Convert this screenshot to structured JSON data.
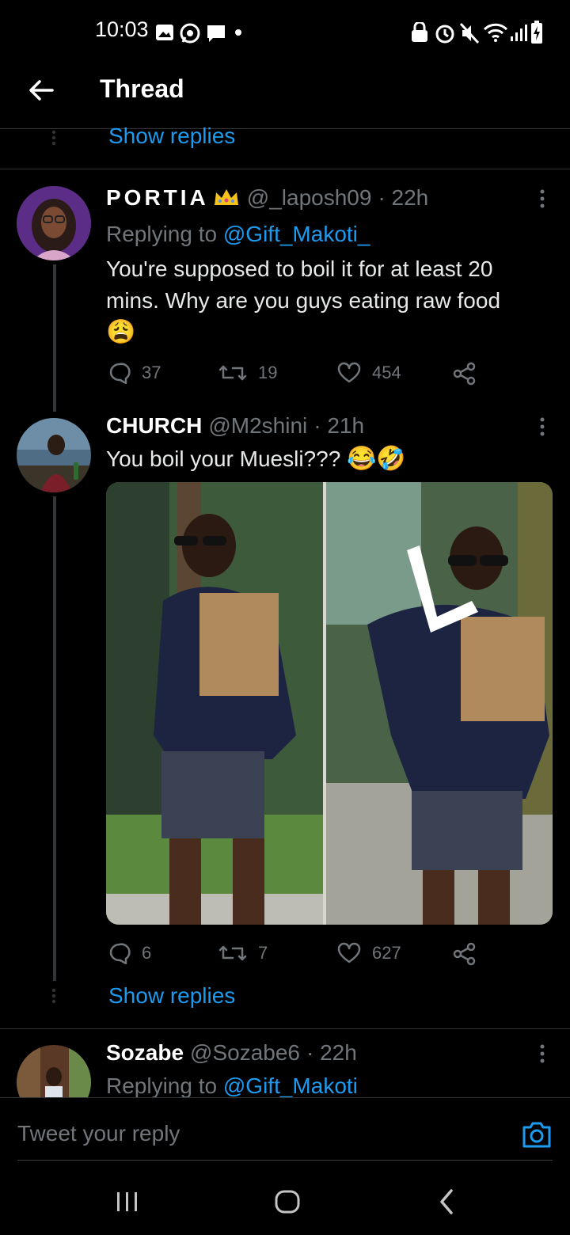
{
  "status": {
    "time": "10:03"
  },
  "header": {
    "title": "Thread"
  },
  "top": {
    "show_replies": "Show replies"
  },
  "tweets": [
    {
      "name": "PORTIA",
      "handle": "@_laposh09",
      "time": "· 22h",
      "replying_prefix": "Replying to ",
      "replying_to": "@Gift_Makoti_",
      "text": "You're supposed to boil it for at least 20 mins. Why are you guys eating raw food",
      "emoji": "😩",
      "replies": "37",
      "retweets": "19",
      "likes": "454"
    },
    {
      "name": "CHURCH",
      "handle": "@M2shini",
      "time": "· 21h",
      "text": "You boil your Muesli???",
      "emoji": "😂🤣",
      "replies": "6",
      "retweets": "7",
      "likes": "627",
      "show_replies": "Show replies"
    },
    {
      "name": "Sozabe",
      "handle": "@Sozabe6",
      "time": "· 22h",
      "replying_prefix": "Replying to ",
      "replying_to": "@Gift_Makoti"
    }
  ],
  "composer": {
    "placeholder": "Tweet your reply"
  },
  "icons": [
    "back-arrow-icon",
    "comment-icon",
    "retweet-icon",
    "heart-icon",
    "share-icon",
    "more-icon",
    "camera-icon",
    "crown-icon"
  ]
}
